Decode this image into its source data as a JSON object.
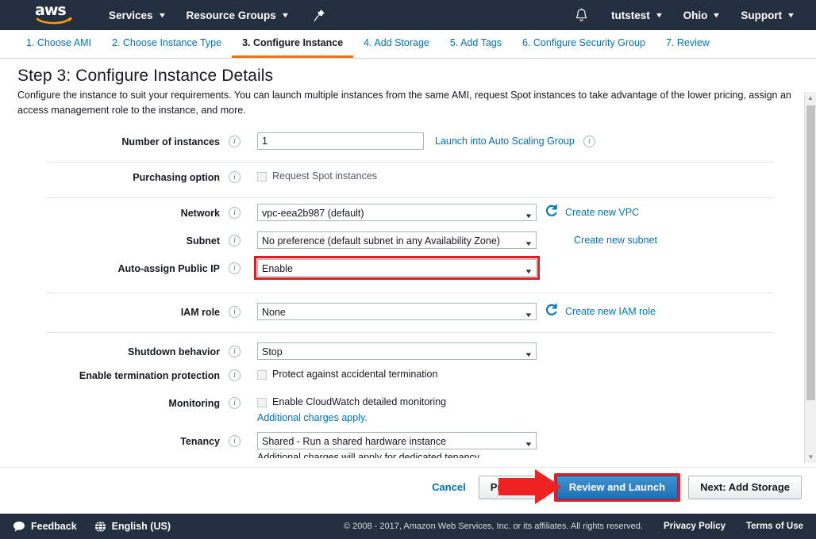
{
  "topnav": {
    "logo_alt": "aws",
    "services_label": "Services",
    "resource_groups_label": "Resource Groups",
    "pin_icon": "pushpin-icon",
    "bell_icon": "bell-icon",
    "account_label": "tutstest",
    "region_label": "Ohio",
    "support_label": "Support",
    "caret": "▼"
  },
  "tabs": [
    {
      "label": "1. Choose AMI",
      "active": false
    },
    {
      "label": "2. Choose Instance Type",
      "active": false
    },
    {
      "label": "3. Configure Instance",
      "active": true
    },
    {
      "label": "4. Add Storage",
      "active": false
    },
    {
      "label": "5. Add Tags",
      "active": false
    },
    {
      "label": "6. Configure Security Group",
      "active": false
    },
    {
      "label": "7. Review",
      "active": false
    }
  ],
  "page": {
    "title": "Step 3: Configure Instance Details",
    "description": "Configure the instance to suit your requirements. You can launch multiple instances from the same AMI, request Spot instances to take advantage of the lower pricing, assign an access management role to the instance, and more."
  },
  "form": {
    "number_of_instances": {
      "label": "Number of instances",
      "value": "1",
      "link": "Launch into Auto Scaling Group"
    },
    "purchasing_option": {
      "label": "Purchasing option",
      "checkbox_label": "Request Spot instances",
      "checked": false
    },
    "network": {
      "label": "Network",
      "value": "vpc-eea2b987 (default)",
      "link": "Create new VPC"
    },
    "subnet": {
      "label": "Subnet",
      "value": "No preference (default subnet in any Availability Zone)",
      "link": "Create new subnet"
    },
    "auto_assign_public_ip": {
      "label": "Auto-assign Public IP",
      "value": "Enable",
      "highlighted": true,
      "highlight_color": "#e11d21"
    },
    "iam_role": {
      "label": "IAM role",
      "value": "None",
      "link": "Create new IAM role"
    },
    "shutdown_behavior": {
      "label": "Shutdown behavior",
      "value": "Stop"
    },
    "termination_protection": {
      "label": "Enable termination protection",
      "checkbox_label": "Protect against accidental termination",
      "checked": false
    },
    "monitoring": {
      "label": "Monitoring",
      "checkbox_label": "Enable CloudWatch detailed monitoring",
      "checked": false,
      "sub_link": "Additional charges apply."
    },
    "tenancy": {
      "label": "Tenancy",
      "value": "Shared - Run a shared hardware instance",
      "clipped_note": "Additional charges will apply for dedicated tenancy."
    }
  },
  "buttons": {
    "cancel": "Cancel",
    "previous": "Previous",
    "review_and_launch": "Review and Launch",
    "next": "Next: Add Storage",
    "review_highlight_color": "#e11d21",
    "arrow_color": "#ee2222"
  },
  "scrollbar": {
    "up_arrow": "▲",
    "down_arrow": "▼"
  },
  "footer": {
    "feedback_label": "Feedback",
    "feedback_icon": "speech-bubble-icon",
    "language_label": "English (US)",
    "language_icon": "globe-icon",
    "copyright": "© 2008 - 2017, Amazon Web Services, Inc. or its affiliates. All rights reserved.",
    "privacy_policy": "Privacy Policy",
    "terms_of_use": "Terms of Use"
  }
}
